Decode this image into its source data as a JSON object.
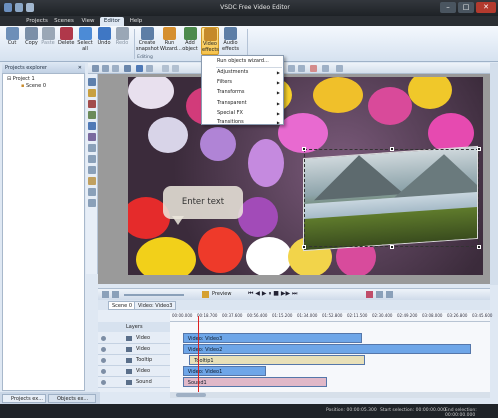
{
  "window": {
    "title": "VSDC Free Video Editor",
    "controls": [
      "–",
      "□",
      "✕"
    ]
  },
  "menu": {
    "tabs": [
      "Projects",
      "Scenes",
      "View",
      "Editor",
      "Help"
    ],
    "active": "Editor"
  },
  "ribbon": {
    "buttons": [
      {
        "label": "Cut",
        "color": "#6d8fb8"
      },
      {
        "label": "Copy",
        "color": "#7a8fa8"
      },
      {
        "label": "Paste",
        "color": "#9aa7b6",
        "dim": true
      },
      {
        "label": "Delete",
        "color": "#b0384a"
      },
      {
        "label": "Select all",
        "color": "#4c8bd6"
      },
      {
        "label": "Undo",
        "color": "#3f77c4"
      },
      {
        "label": "Redo",
        "color": "#9aa7b6",
        "dim": true
      },
      {
        "label": "Create snapshot",
        "color": "#5d7ea6"
      },
      {
        "label": "Run Wizard...",
        "color": "#d58f2f"
      },
      {
        "label": "Add object",
        "color": "#4d8b4d"
      },
      {
        "label": "Video effects",
        "color": "#c58a2a",
        "active": true
      },
      {
        "label": "Audio effects",
        "color": "#5d7ea6"
      }
    ],
    "group_label": "Editing"
  },
  "effects_menu": {
    "items": [
      {
        "label": "Run objects wizard...",
        "submenu": false
      },
      {
        "label": "Adjustments",
        "submenu": true
      },
      {
        "label": "Filters",
        "submenu": true
      },
      {
        "label": "Transforms",
        "submenu": true
      },
      {
        "label": "Transparent",
        "submenu": true
      },
      {
        "label": "Special FX",
        "submenu": true
      },
      {
        "label": "Transitions",
        "submenu": true
      }
    ]
  },
  "explorer": {
    "title": "Projects explorer",
    "close": "✕",
    "items": [
      {
        "label": "Project 1",
        "level": 0
      },
      {
        "label": "Scene 0",
        "level": 1
      }
    ],
    "tabs": [
      "Projects ex...",
      "Objects ex..."
    ]
  },
  "canvas": {
    "text_object": "Enter text"
  },
  "transport": {
    "preview_label": "Preview"
  },
  "timeline": {
    "tabs": [
      "Scene 0",
      "Video: Video3"
    ],
    "ruler_marks": [
      "00:00.000",
      "00:18.700",
      "00:37.600",
      "00:56.400",
      "01:15.200",
      "01:34.000",
      "01:52.800",
      "02:11.500",
      "02:30.400",
      "02:49.200",
      "03:08.000",
      "03:26.800",
      "03:45.600"
    ],
    "layers_label": "Layers",
    "tracks": [
      {
        "name": "Video",
        "clip": "Video: Video3",
        "clip_color": "#6ea6e8",
        "start": 0.04,
        "width": 0.56
      },
      {
        "name": "Video",
        "clip": "Video: Video2",
        "clip_color": "#6ea6e8",
        "start": 0.04,
        "width": 0.9
      },
      {
        "name": "Tooltip",
        "clip": "Tooltip1",
        "clip_color": "#e8e0b8",
        "start": 0.06,
        "width": 0.55
      },
      {
        "name": "Video",
        "clip": "Video: Video1",
        "clip_color": "#6ea6e8",
        "start": 0.04,
        "width": 0.26
      },
      {
        "name": "Sound",
        "clip": "Sound1",
        "clip_color": "#e0b8c8",
        "start": 0.04,
        "width": 0.45
      }
    ]
  },
  "status": {
    "position": "Position:  00:00:05.300",
    "start_selection": "Start selection:  00:00:00.000",
    "end_selection": "End selection:  00:00:00.000"
  }
}
